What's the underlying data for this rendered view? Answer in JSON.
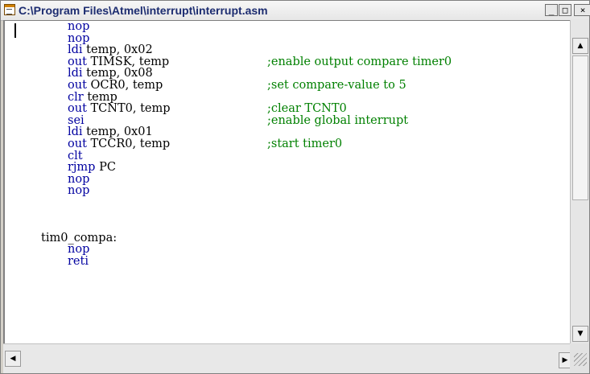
{
  "window": {
    "title": "C:\\Program Files\\Atmel\\interrupt\\interrupt.asm",
    "min_glyph": "_",
    "max_glyph": "□",
    "close_glyph": "×"
  },
  "code": [
    {
      "type": "instr",
      "text": "nop"
    },
    {
      "type": "instr",
      "text": "nop"
    },
    {
      "type": "instr",
      "mnemonic": "ldi",
      "operands": "temp, 0x02"
    },
    {
      "type": "instr",
      "mnemonic": "out",
      "operands": "TIMSK, temp",
      "comment": ";enable output compare timer0"
    },
    {
      "type": "instr",
      "mnemonic": "ldi",
      "operands": "temp, 0x08"
    },
    {
      "type": "instr",
      "mnemonic": "out",
      "operands": "OCR0, temp",
      "comment": ";set compare-value to 5"
    },
    {
      "type": "instr",
      "mnemonic": "clr",
      "operands": "temp"
    },
    {
      "type": "instr",
      "mnemonic": "out",
      "operands": "TCNT0, temp",
      "comment": ";clear TCNT0"
    },
    {
      "type": "instr",
      "text": "sei",
      "comment": ";enable global interrupt"
    },
    {
      "type": "instr",
      "mnemonic": "ldi",
      "operands": "temp, 0x01"
    },
    {
      "type": "instr",
      "mnemonic": "out",
      "operands": "TCCR0, temp",
      "comment": ";start timer0"
    },
    {
      "type": "instr",
      "text": "clt"
    },
    {
      "type": "instr",
      "mnemonic": "rjmp",
      "operands": "PC"
    },
    {
      "type": "instr",
      "text": "nop"
    },
    {
      "type": "instr",
      "text": "nop"
    },
    {
      "type": "blank"
    },
    {
      "type": "blank"
    },
    {
      "type": "blank"
    },
    {
      "type": "label",
      "text": "tim0_compa:"
    },
    {
      "type": "instr",
      "text": "nop"
    },
    {
      "type": "instr",
      "text": "reti"
    }
  ],
  "scroll_icons": {
    "up": "up-arrow-icon",
    "down": "down-arrow-icon",
    "left": "left-arrow-icon",
    "right": "right-arrow-icon"
  },
  "colors": {
    "instruction": "#0000a0",
    "comment": "#008000",
    "title": "#1c2c70"
  }
}
